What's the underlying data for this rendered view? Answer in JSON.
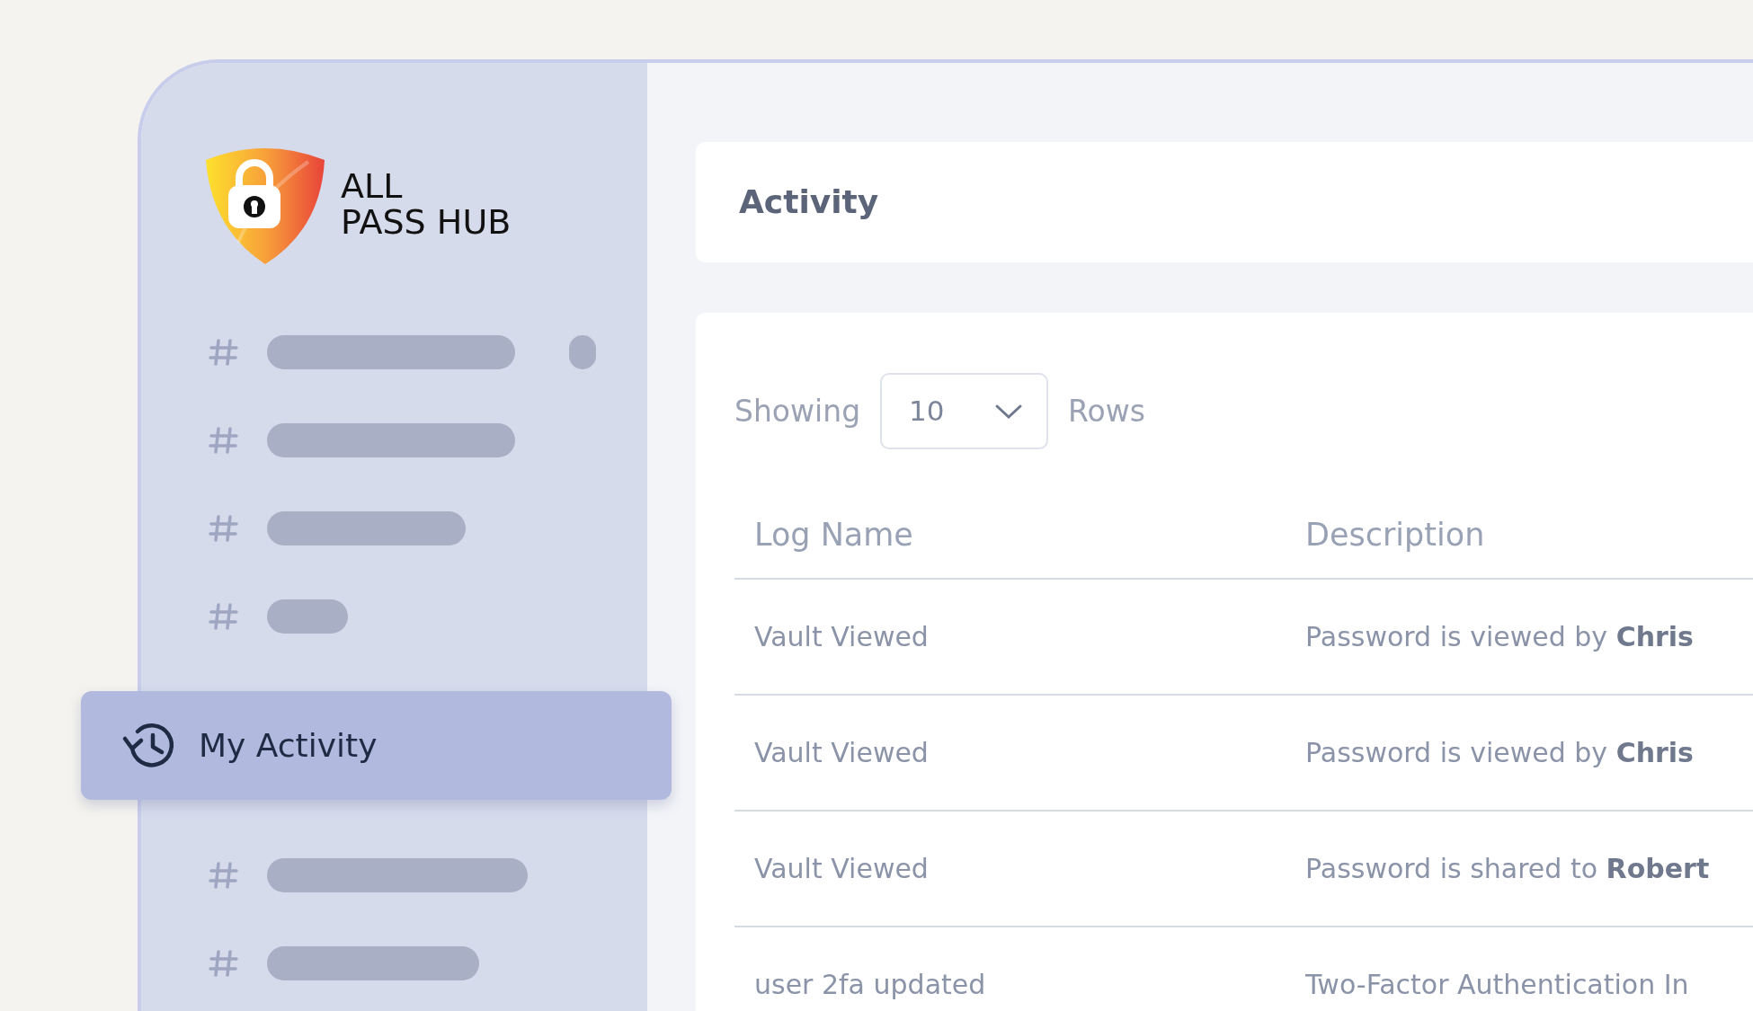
{
  "brand": {
    "line1": "ALL",
    "line2": "PASS HUB"
  },
  "sidebar": {
    "items": [
      {
        "kind": "placeholder",
        "has_badge": true,
        "selected": false
      },
      {
        "kind": "placeholder",
        "has_badge": false,
        "selected": false
      },
      {
        "kind": "placeholder",
        "has_badge": false,
        "selected": false
      },
      {
        "kind": "placeholder",
        "has_badge": false,
        "selected": false
      },
      {
        "kind": "link",
        "label": "My Activity",
        "has_badge": false,
        "selected": true
      },
      {
        "kind": "placeholder",
        "has_badge": false,
        "selected": false
      },
      {
        "kind": "placeholder",
        "has_badge": false,
        "selected": false
      }
    ]
  },
  "header": {
    "title": "Activity"
  },
  "rows_control": {
    "before": "Showing",
    "value": "10",
    "after": "Rows"
  },
  "table": {
    "columns": [
      "Log Name",
      "Description"
    ],
    "rows": [
      {
        "log_name": "Vault Viewed",
        "description": "Password is viewed by **Chris**"
      },
      {
        "log_name": "Vault Viewed",
        "description": "Password is viewed by **Chris**"
      },
      {
        "log_name": "Vault Viewed",
        "description": "Password is shared to **Robert**"
      },
      {
        "log_name": "user 2fa updated",
        "description": "Two-Factor Authentication In"
      }
    ]
  }
}
